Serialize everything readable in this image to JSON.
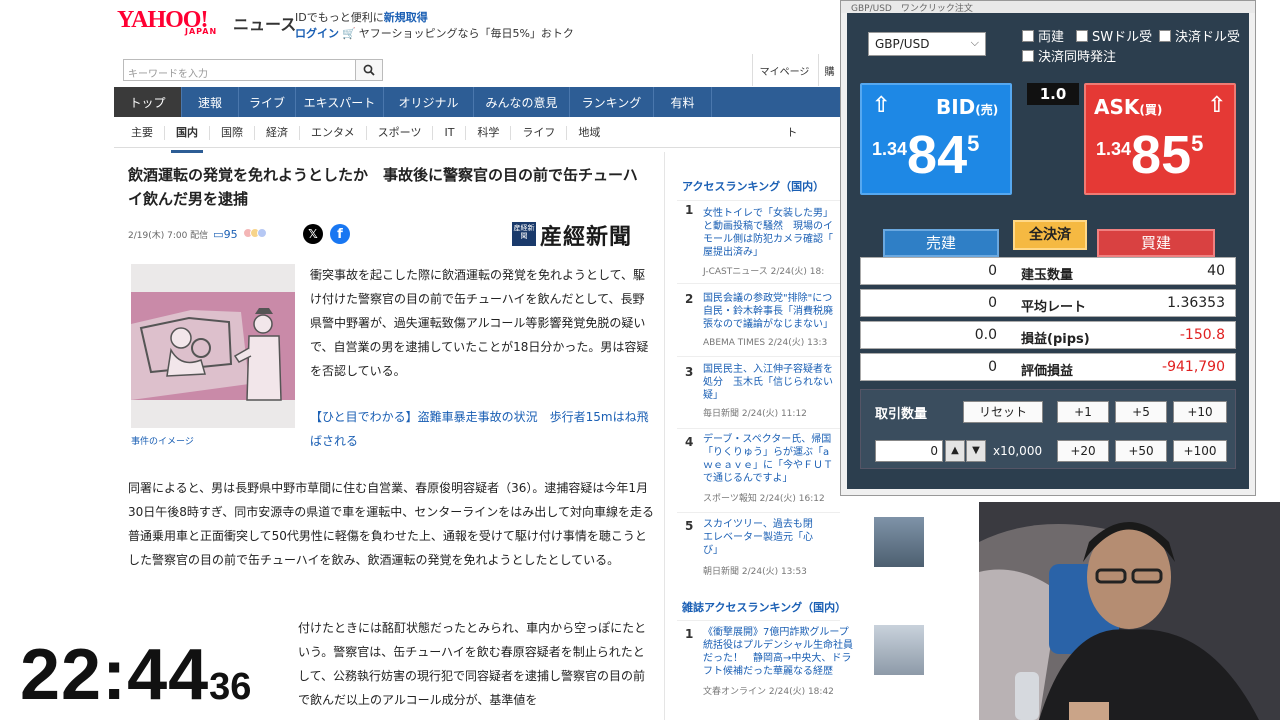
{
  "header": {
    "logo": "YAHOO!",
    "logo_sub": "JAPAN",
    "service": "ニュース",
    "promo_text": "IDでもっと便利に",
    "promo_link": "新規取得",
    "login": "ログイン",
    "shopping": "ヤフーショッピングなら「毎日5%」おトク",
    "search_placeholder": "キーワードを入力",
    "mypage": "マイページ",
    "extra": "購"
  },
  "nav_main": [
    "トップ",
    "速報",
    "ライブ",
    "エキスパート",
    "オリジナル",
    "みんなの意見",
    "ランキング",
    "有料"
  ],
  "nav_sub": [
    "主要",
    "国内",
    "国際",
    "経済",
    "エンタメ",
    "スポーツ",
    "IT",
    "科学",
    "ライフ",
    "地域",
    "ト"
  ],
  "article": {
    "title": "飲酒運転の発覚を免れようとしたか　事故後に警察官の目の前で缶チューハイ飲んだ男を逮捕",
    "date": "2/19(木) 7:00 配信",
    "comments": "95",
    "publisher": "産經新聞",
    "publisher_mark": "産経新聞",
    "caption": "事件のイメージ",
    "lead": "衝突事故を起こした際に飲酒運転の発覚を免れようとして、駆け付けた警察官の目の前で缶チューハイを飲んだとして、長野県警中野署が、過失運転致傷アルコール等影響発覚免脱の疑いで、自営業の男を逮捕していたことが18日分かった。男は容疑を否認している。",
    "related": "【ひと目でわかる】盗難車暴走事故の状況　歩行者15mはね飛ばされる",
    "body1": "同署によると、男は長野県中野市草間に住む自営業、春原俊明容疑者（36）。逮捕容疑は今年1月30日午後8時すぎ、同市安源寺の県道で車を運転中、センターラインをはみ出して対向車線を走る普通乗用車と正面衝突して50代男性に軽傷を負わせた上、通報を受けて駆け付け事情を聴こうとした警察官の目の前で缶チューハイを飲み、飲酒運転の発覚を免れようとしたとしている。",
    "body2": "付けたときには酩酊状態だったとみられ、車内から空っぽにたという。警察官は、缶チューハイを飲む春原容疑者を制止られたとして、公務執行妨害の現行犯で同容疑者を逮捕し警察官の目の前で飲んだ以上のアルコール成分が、基準値を"
  },
  "ranking": {
    "title": "アクセスランキング（国内）",
    "items": [
      {
        "num": "1",
        "lines": [
          "女性トイレで「女装した男」",
          "と動画投稿で騒然　現場のイ",
          "モール側は防犯カメラ確認「",
          "屋提出済み」"
        ],
        "src": "J-CASTニュース 2/24(火) 18:"
      },
      {
        "num": "2",
        "lines": [
          "国民会議の参政党\"排除\"につ",
          "自民・鈴木幹事長「消費税廃",
          "張なので議論がなじまない」"
        ],
        "src": "ABEMA TIMES 2/24(火) 13:3"
      },
      {
        "num": "3",
        "lines": [
          "国民民主、入江伸子容疑者を",
          "処分　玉木氏「信じられない",
          "疑」"
        ],
        "src": "毎日新聞 2/24(火) 11:12"
      },
      {
        "num": "4",
        "lines": [
          "デーブ・スペクター氏、帰国",
          "「りくりゅう」らが運ぶ「a",
          "ｗｅａｖｅ」に「今やＦＵＴ",
          "で通じるんですよ」"
        ],
        "src": "スポーツ報知 2/24(火) 16:12"
      },
      {
        "num": "5",
        "lines": [
          "スカイツリー、過去も閉じ込め",
          "エレベーター製造元「心からおわ",
          "び」"
        ],
        "src": "朝日新聞 2/24(火) 13:53"
      }
    ],
    "title2": "雑誌アクセスランキング（国内）",
    "mag_item": {
      "num": "1",
      "lines": [
        "《衝撃展開》7億円詐欺グループ",
        "統括役はプルデンシャル生命社員",
        "だった！　静岡高→中央大、ドラ",
        "フト候補だった華麗なる経歴"
      ],
      "src": "文春オンライン 2/24(火) 18:42"
    }
  },
  "fx": {
    "title": "GBP/USD　ワンクリック注文",
    "pair": "GBP/USD",
    "checks": [
      "両建",
      "SWドル受",
      "決済ドル受",
      "決済同時発注"
    ],
    "spread": "1.0",
    "bid": {
      "label": "BID",
      "sub": "(売)",
      "pre": "1.34",
      "big": "84",
      "pip": "5"
    },
    "ask": {
      "label": "ASK",
      "sub": "(買)",
      "pre": "1.34",
      "big": "85",
      "pip": "5"
    },
    "tab_sell": "売建",
    "tab_close": "全決済",
    "tab_buy": "買建",
    "rows": [
      {
        "left": "0",
        "label": "建玉数量",
        "right": "40"
      },
      {
        "left": "0",
        "label": "平均レート",
        "right": "1.36353"
      },
      {
        "left": "0.0",
        "label": "損益(pips)",
        "right": "-150.8"
      },
      {
        "left": "0",
        "label": "評価損益",
        "right": "-941,790"
      }
    ],
    "lot_label": "取引数量",
    "reset": "リセット",
    "steps": [
      "+1",
      "+5",
      "+10",
      "+20",
      "+50",
      "+100"
    ],
    "lot_value": "0",
    "multiplier": "x10,000"
  },
  "clock": {
    "hm": "22:44",
    "ss": "36"
  }
}
